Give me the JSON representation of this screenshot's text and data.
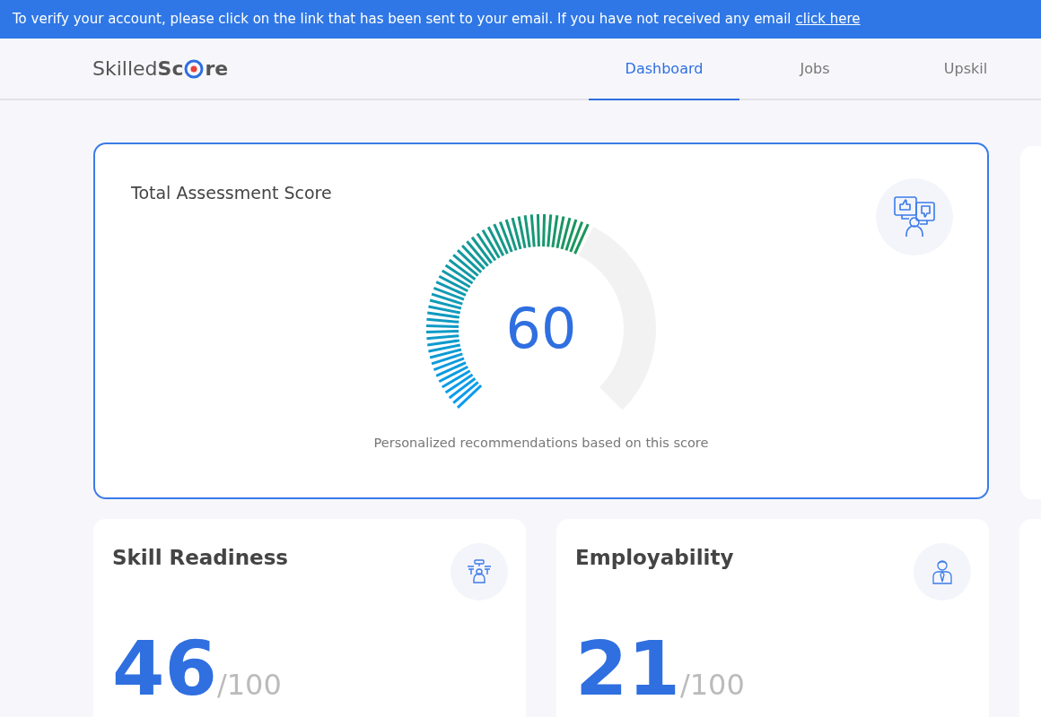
{
  "banner": {
    "text": "To verify your account, please click on the link that has been sent to your email. If you have not received any email",
    "link": "click here"
  },
  "logo": {
    "light": "Skilled",
    "bold_start": "Sc",
    "bold_end": "re"
  },
  "nav": [
    {
      "label": "Dashboard",
      "selected": true
    },
    {
      "label": "Jobs",
      "selected": false
    },
    {
      "label": "Upskil",
      "selected": false
    }
  ],
  "score_card": {
    "title": "Total Assessment Score",
    "score": "60",
    "caption": "Personalized recommendations based on this score"
  },
  "metric_cards": [
    {
      "kind": "skill",
      "title": "Skill Readiness",
      "value": "46",
      "suffix": "/100"
    },
    {
      "kind": "employability",
      "title": "Employability",
      "value": "21",
      "suffix": "/100"
    }
  ]
}
